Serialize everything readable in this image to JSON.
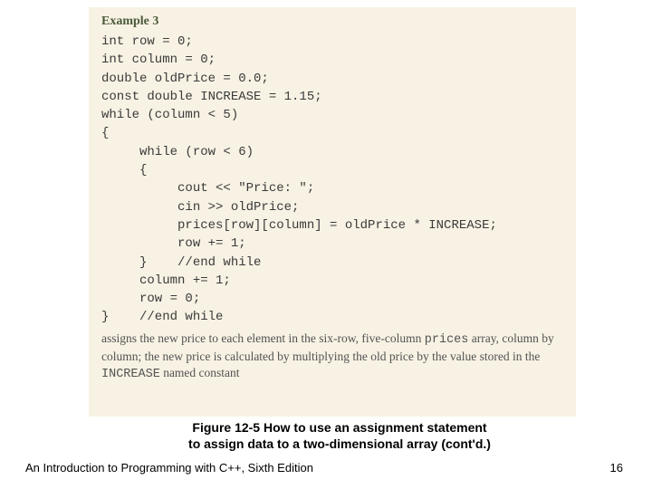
{
  "panel": {
    "header": "Example 3",
    "lines": [
      "int row = 0;",
      "int column = 0;",
      "double oldPrice = 0.0;",
      "const double INCREASE = 1.15;",
      "while (column < 5)",
      "{",
      "     while (row < 6)",
      "     {",
      "          cout << \"Price: \";",
      "          cin >> oldPrice;",
      "          prices[row][column] = oldPrice * INCREASE;",
      "          row += 1;",
      "     }    //end while",
      "     column += 1;",
      "     row = 0;",
      "}    //end while"
    ],
    "desc_part1": "assigns the new price to each element in the six-row, five-column ",
    "desc_mono1": "prices",
    "desc_part2": " array, column by column; the new price is calculated by multiplying the old price by the value stored in the ",
    "desc_mono2": "INCREASE",
    "desc_part3": " named constant"
  },
  "caption": {
    "line1": "Figure 12-5 How to use an assignment statement",
    "line2": "to assign data to a two-dimensional array (cont'd.)"
  },
  "footer": {
    "left": "An Introduction to Programming with C++, Sixth Edition",
    "right": "16"
  }
}
